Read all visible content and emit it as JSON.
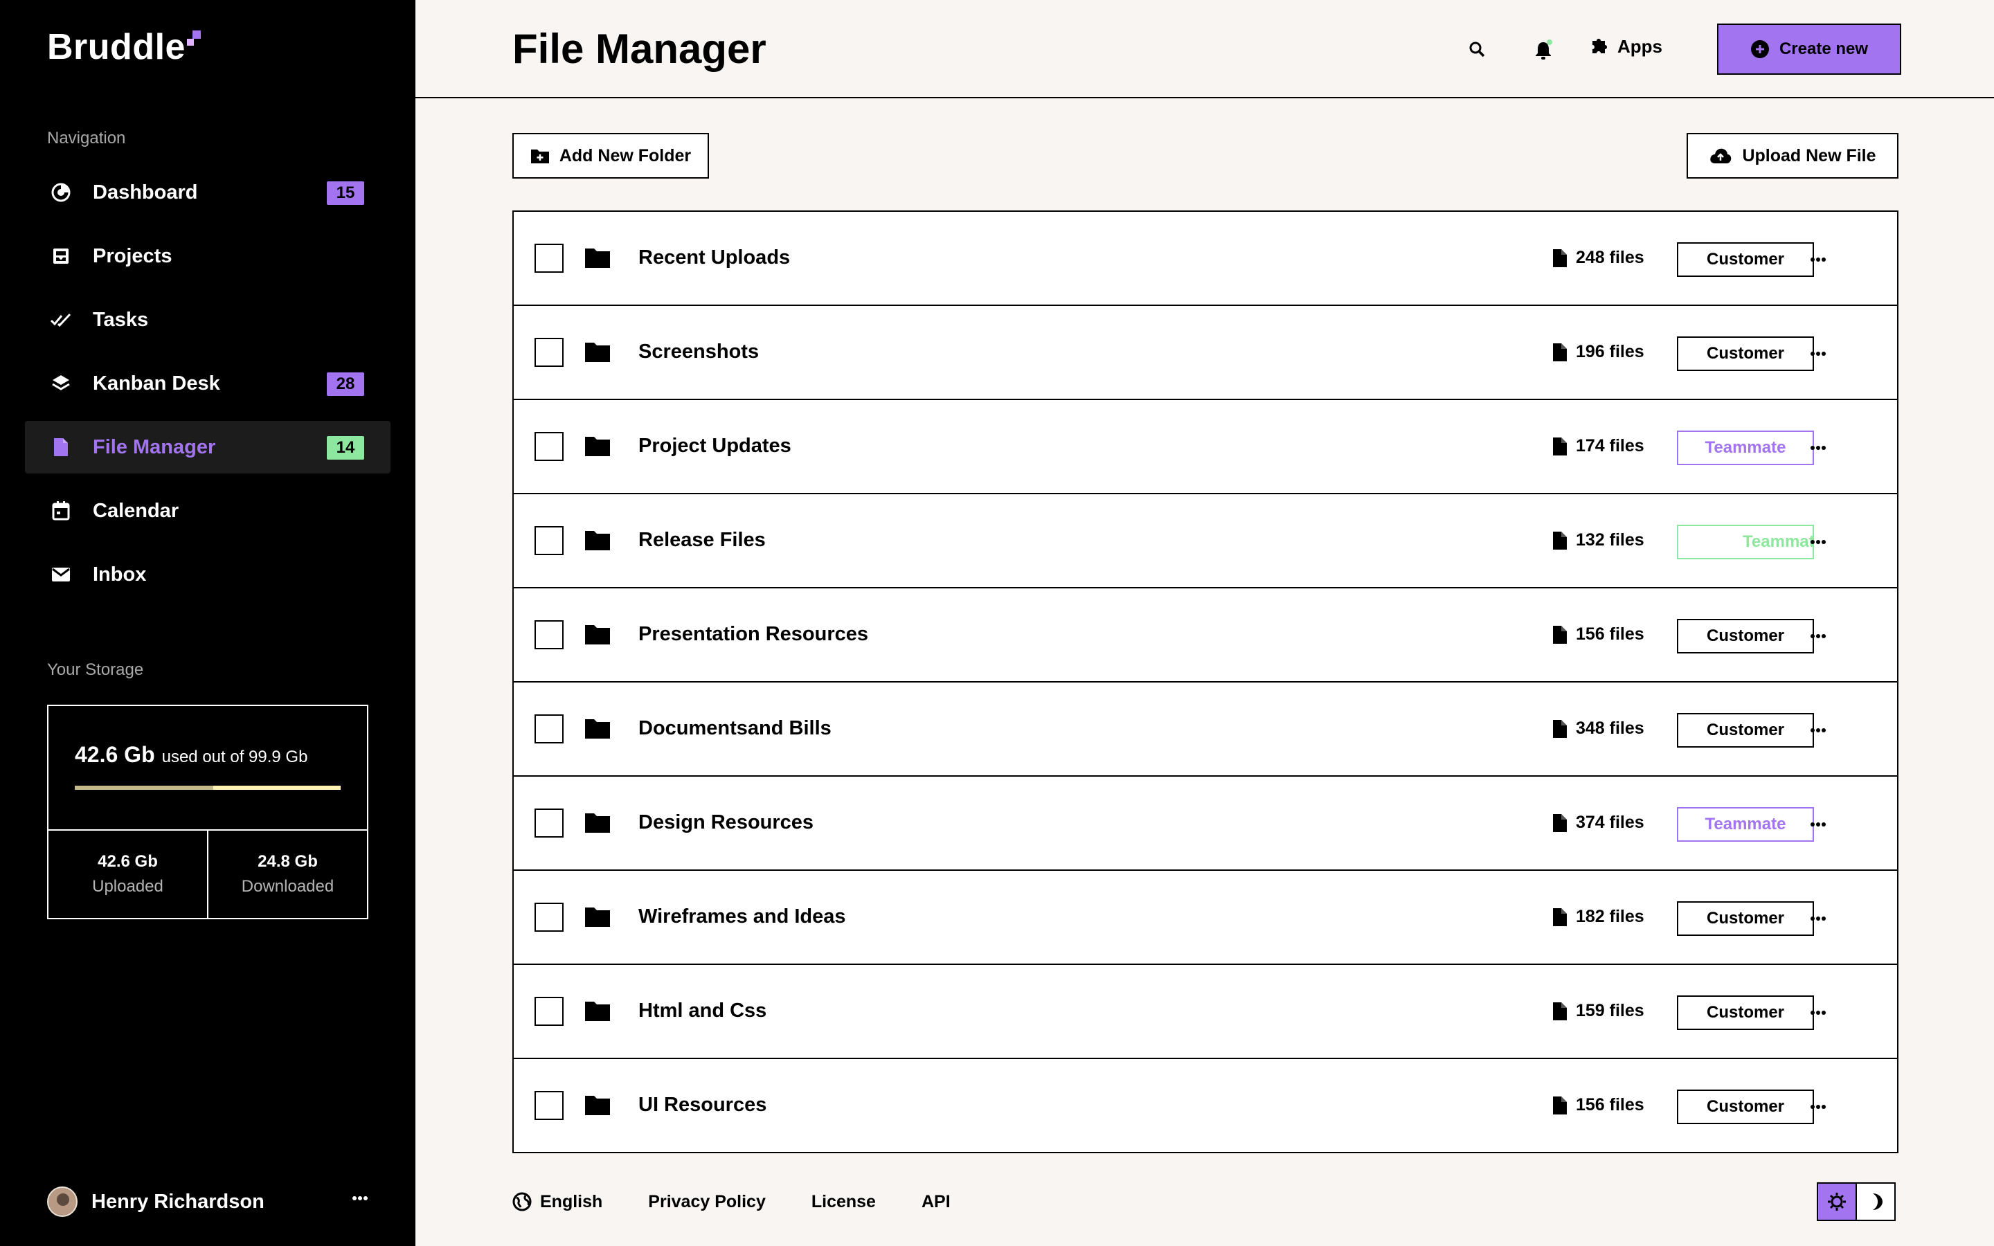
{
  "app": {
    "name": "Bruddle"
  },
  "sidebar": {
    "nav_label": "Navigation",
    "items": [
      {
        "label": "Dashboard",
        "icon": "dashboard-icon",
        "badge": "15",
        "badge_color": "#a374f0"
      },
      {
        "label": "Projects",
        "icon": "inbox-tray-icon"
      },
      {
        "label": "Tasks",
        "icon": "double-check-icon"
      },
      {
        "label": "Kanban Desk",
        "icon": "layers-icon",
        "badge": "28",
        "badge_color": "#a374f0"
      },
      {
        "label": "File Manager",
        "icon": "file-icon",
        "badge": "14",
        "badge_color": "#8ee79e",
        "active": true
      },
      {
        "label": "Calendar",
        "icon": "calendar-icon"
      },
      {
        "label": "Inbox",
        "icon": "mail-icon"
      }
    ],
    "storage": {
      "label": "Your Storage",
      "used": "42.6 Gb",
      "used_suffix": "used out of 99.9 Gb",
      "used_fraction": 0.52,
      "uploaded_value": "42.6 Gb",
      "uploaded_label": "Uploaded",
      "downloaded_value": "24.8 Gb",
      "downloaded_label": "Downloaded"
    },
    "user": {
      "name": "Henry Richardson"
    }
  },
  "header": {
    "title": "File Manager",
    "apps_label": "Apps",
    "create_label": "Create new"
  },
  "toolbar": {
    "add_folder_label": "Add New Folder",
    "upload_label": "Upload New File"
  },
  "folders": [
    {
      "name": "Recent Uploads",
      "count": "248 files",
      "tag": "Customer",
      "tag_style": "customer"
    },
    {
      "name": "Screenshots",
      "count": "196 files",
      "tag": "Customer",
      "tag_style": "customer"
    },
    {
      "name": "Project Updates",
      "count": "174 files",
      "tag": "Teammate",
      "tag_style": "teammate"
    },
    {
      "name": "Release Files",
      "count": "132 files",
      "tag": "Teammate",
      "tag_style": "teammate-green"
    },
    {
      "name": "Presentation Resources",
      "count": "156 files",
      "tag": "Customer",
      "tag_style": "customer"
    },
    {
      "name": "Documentsand Bills",
      "count": "348 files",
      "tag": "Customer",
      "tag_style": "customer"
    },
    {
      "name": "Design Resources",
      "count": "374 files",
      "tag": "Teammate",
      "tag_style": "teammate"
    },
    {
      "name": "Wireframes and Ideas",
      "count": "182 files",
      "tag": "Customer",
      "tag_style": "customer"
    },
    {
      "name": "Html and Css",
      "count": "159 files",
      "tag": "Customer",
      "tag_style": "customer"
    },
    {
      "name": "UI Resources",
      "count": "156 files",
      "tag": "Customer",
      "tag_style": "customer"
    }
  ],
  "footer": {
    "language": "English",
    "privacy": "Privacy Policy",
    "license": "License",
    "api": "API"
  },
  "colors": {
    "accent": "#a374f0",
    "success": "#8ee79e",
    "background": "#f8f5f2",
    "sidebar": "#000000"
  }
}
